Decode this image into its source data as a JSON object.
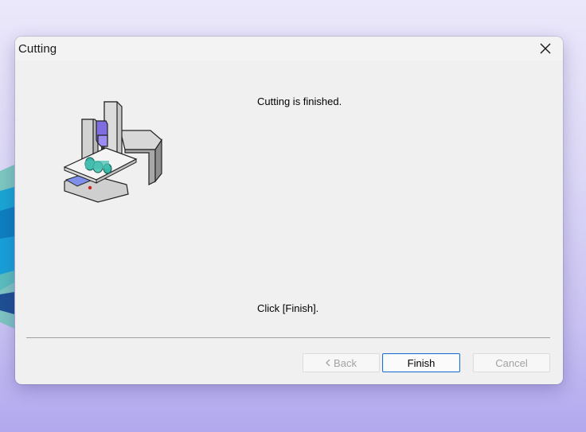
{
  "window": {
    "title": "Cutting",
    "close_icon": "close-icon"
  },
  "illustration": {
    "icon": "milling-machine-icon"
  },
  "content": {
    "status_message": "Cutting is finished.",
    "instruction": "Click [Finish]."
  },
  "buttons": {
    "back_label": "Back",
    "back_icon": "chevron-left-icon",
    "finish_label": "Finish",
    "cancel_label": "Cancel",
    "back_enabled": false,
    "cancel_enabled": false
  },
  "colors": {
    "accent": "#1f6fcf",
    "disabled_text": "#a2a2a2",
    "dialog_bg": "#f0f0f0"
  }
}
